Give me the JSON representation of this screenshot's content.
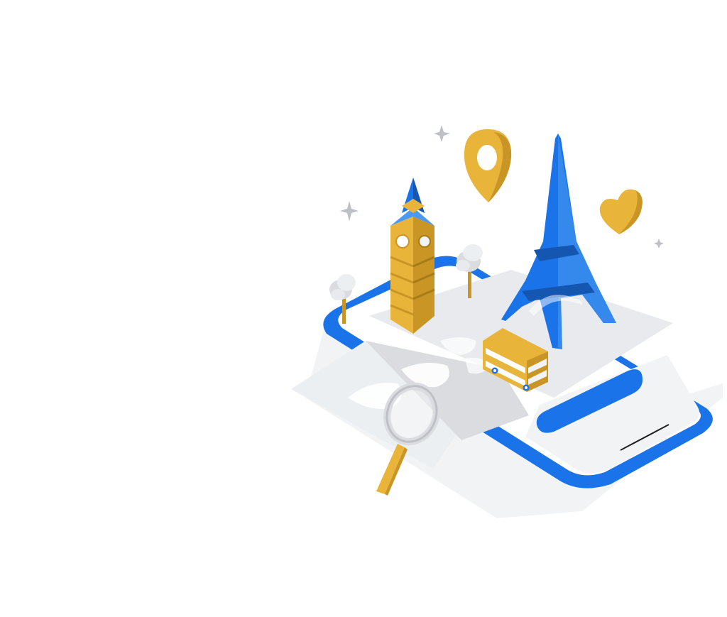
{
  "illustration": {
    "subject": "travel",
    "landmarks": [
      "big-ben",
      "eiffel-tower"
    ],
    "objects": [
      "phone",
      "world-map",
      "magnifying-glass",
      "double-decker-bus",
      "location-pin",
      "heart",
      "trees",
      "sparkles"
    ],
    "colors": {
      "background": "#ffffff",
      "primary_blue": "#1a73e8",
      "light_blue": "#4c9af0",
      "gold": "#e8b53a",
      "gold_dark": "#c99625",
      "light_gray": "#eceff1",
      "mid_gray": "#d5d9dc",
      "dark_gray": "#9aa0a6"
    }
  }
}
